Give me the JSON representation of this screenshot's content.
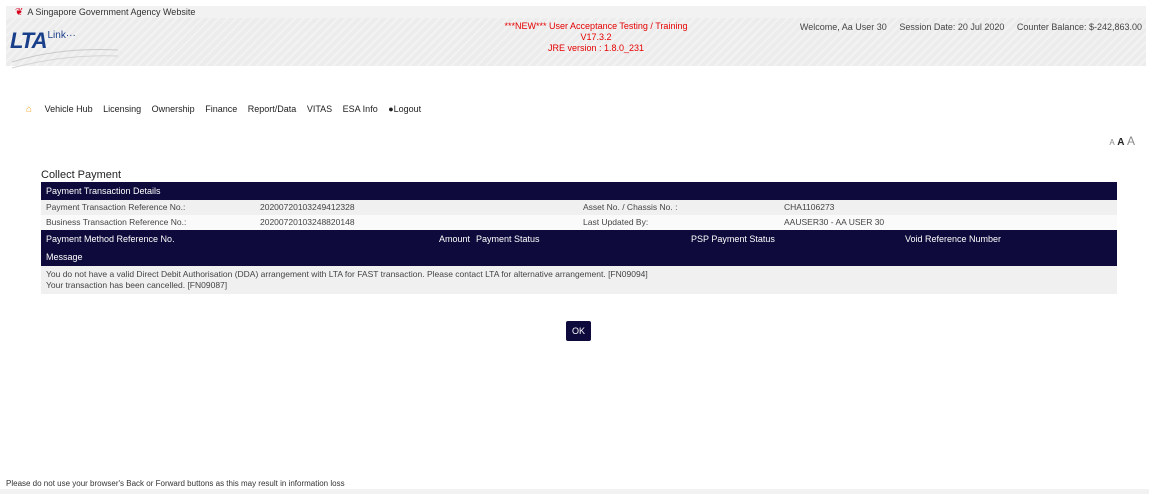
{
  "gov_banner": "A Singapore Government Agency Website",
  "logo": {
    "main": "LTA",
    "suffix": "Link···"
  },
  "environment": {
    "line1": "***NEW*** User Acceptance Testing / Training",
    "line2": "V17.3.2",
    "line3": "JRE version : 1.8.0_231"
  },
  "session": {
    "welcome": "Welcome, Aa User 30",
    "date": "Session Date: 20 Jul 2020",
    "balance": "Counter Balance: $-242,863.00"
  },
  "nav": {
    "items": [
      "Vehicle Hub",
      "Licensing",
      "Ownership",
      "Finance",
      "Report/Data",
      "VITAS",
      "ESA Info"
    ],
    "logout": "Logout"
  },
  "font_sizer": {
    "small": "A",
    "medium": "A",
    "large": "A"
  },
  "page_title": "Collect Payment",
  "ptd": {
    "header": "Payment Transaction Details",
    "row1": {
      "label_left": "Payment Transaction Reference No.:",
      "value_left": "20200720103249412328",
      "label_right": "Asset No. / Chassis No. :",
      "value_right": "CHA1106273"
    },
    "row2": {
      "label_left": "Business Transaction Reference No.:",
      "value_left": "20200720103248820148",
      "label_right": "Last Updated By:",
      "value_right": "AAUSER30 - AA USER 30"
    }
  },
  "payment_columns": {
    "ref": "Payment Method Reference No.",
    "amount": "Amount",
    "status": "Payment Status",
    "psp": "PSP Payment Status",
    "void": "Void Reference Number"
  },
  "message": {
    "header": "Message",
    "line1": "You do not have a valid Direct Debit Authorisation (DDA) arrangement with LTA for FAST transaction. Please contact LTA for alternative arrangement. [FN09094]",
    "line2": "Your transaction has been cancelled. [FN09087]"
  },
  "ok_label": "OK",
  "footer_note": "Please do not use your browser's Back or Forward buttons as this may result in information loss"
}
